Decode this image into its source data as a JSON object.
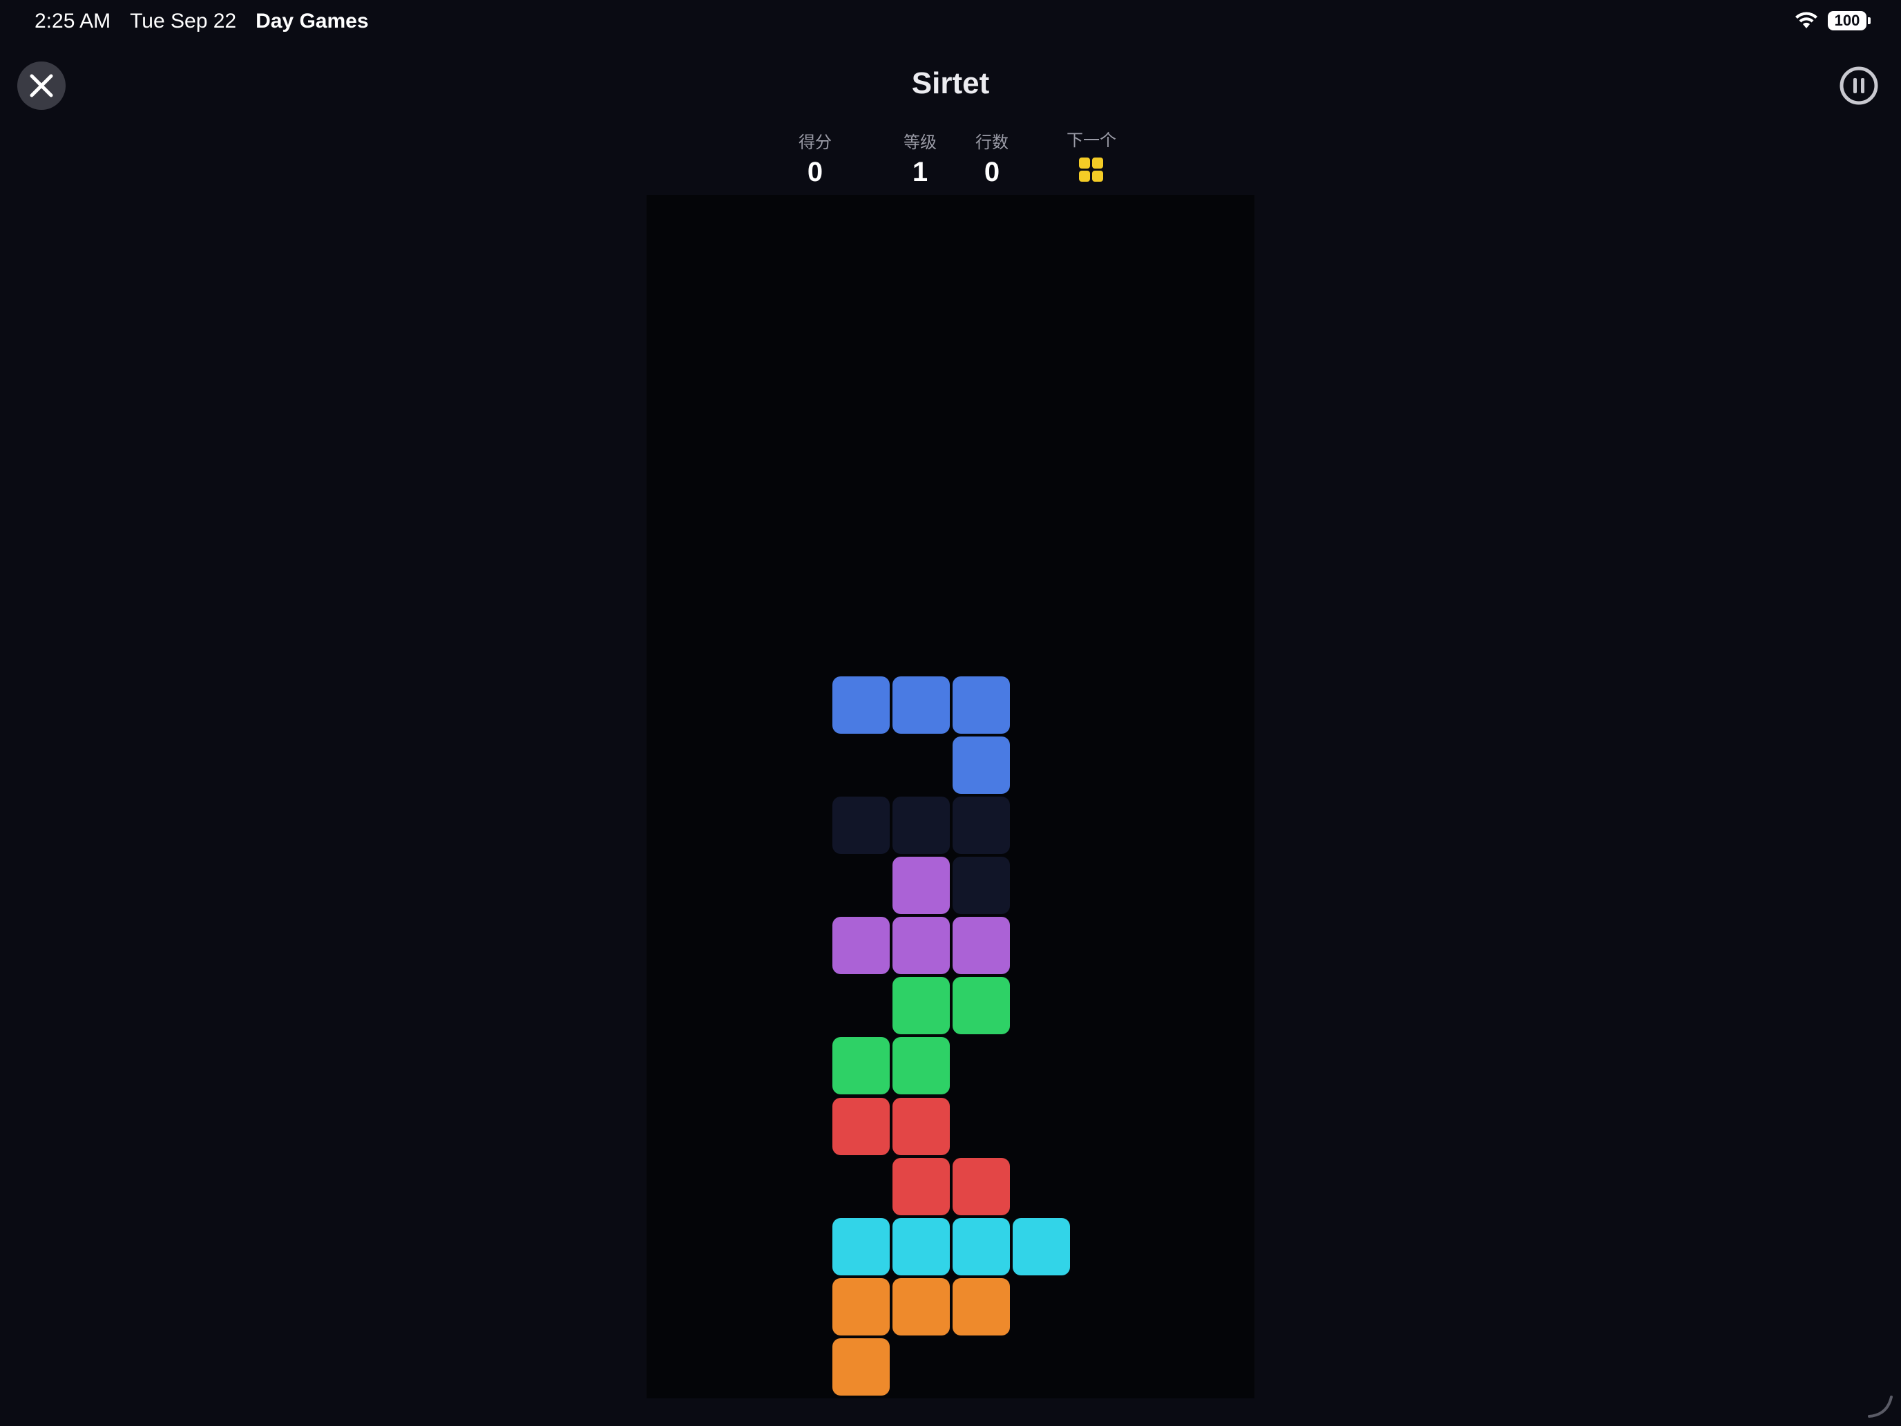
{
  "status_bar": {
    "time": "2:25 AM",
    "date": "Tue Sep 22",
    "app_name": "Day Games",
    "battery": "100"
  },
  "header": {
    "title": "Sirtet"
  },
  "stats": {
    "score_label": "得分",
    "score_value": "0",
    "level_label": "等级",
    "level_value": "1",
    "lines_label": "行数",
    "lines_value": "0",
    "next_label": "下一个"
  },
  "next_piece": {
    "type": "O",
    "color": "#f4cc26"
  },
  "colors": {
    "background": "#0a0b13",
    "board": "#040508",
    "blue": "#4a7be3",
    "ghost": "#111528",
    "purple": "#ab62d6",
    "green": "#2ed166",
    "red": "#e34646",
    "cyan": "#32d4e8",
    "orange": "#ee8a2c",
    "yellow": "#f4cc26"
  },
  "board": {
    "columns": 10,
    "rows": 20,
    "cells": [
      {
        "row": 8,
        "col": 3,
        "color": "blue",
        "kind": "active"
      },
      {
        "row": 8,
        "col": 4,
        "color": "blue",
        "kind": "active"
      },
      {
        "row": 8,
        "col": 5,
        "color": "blue",
        "kind": "active"
      },
      {
        "row": 9,
        "col": 5,
        "color": "blue",
        "kind": "active"
      },
      {
        "row": 10,
        "col": 3,
        "color": "ghost",
        "kind": "ghost"
      },
      {
        "row": 10,
        "col": 4,
        "color": "ghost",
        "kind": "ghost"
      },
      {
        "row": 10,
        "col": 5,
        "color": "ghost",
        "kind": "ghost"
      },
      {
        "row": 11,
        "col": 5,
        "color": "ghost",
        "kind": "ghost"
      },
      {
        "row": 11,
        "col": 4,
        "color": "purple",
        "kind": "locked"
      },
      {
        "row": 12,
        "col": 3,
        "color": "purple",
        "kind": "locked"
      },
      {
        "row": 12,
        "col": 4,
        "color": "purple",
        "kind": "locked"
      },
      {
        "row": 12,
        "col": 5,
        "color": "purple",
        "kind": "locked"
      },
      {
        "row": 13,
        "col": 4,
        "color": "green",
        "kind": "locked"
      },
      {
        "row": 13,
        "col": 5,
        "color": "green",
        "kind": "locked"
      },
      {
        "row": 14,
        "col": 3,
        "color": "green",
        "kind": "locked"
      },
      {
        "row": 14,
        "col": 4,
        "color": "green",
        "kind": "locked"
      },
      {
        "row": 15,
        "col": 3,
        "color": "red",
        "kind": "locked"
      },
      {
        "row": 15,
        "col": 4,
        "color": "red",
        "kind": "locked"
      },
      {
        "row": 16,
        "col": 4,
        "color": "red",
        "kind": "locked"
      },
      {
        "row": 16,
        "col": 5,
        "color": "red",
        "kind": "locked"
      },
      {
        "row": 17,
        "col": 3,
        "color": "cyan",
        "kind": "locked"
      },
      {
        "row": 17,
        "col": 4,
        "color": "cyan",
        "kind": "locked"
      },
      {
        "row": 17,
        "col": 5,
        "color": "cyan",
        "kind": "locked"
      },
      {
        "row": 17,
        "col": 6,
        "color": "cyan",
        "kind": "locked"
      },
      {
        "row": 18,
        "col": 3,
        "color": "orange",
        "kind": "locked"
      },
      {
        "row": 18,
        "col": 4,
        "color": "orange",
        "kind": "locked"
      },
      {
        "row": 18,
        "col": 5,
        "color": "orange",
        "kind": "locked"
      },
      {
        "row": 19,
        "col": 3,
        "color": "orange",
        "kind": "locked"
      }
    ]
  }
}
